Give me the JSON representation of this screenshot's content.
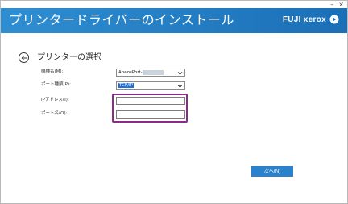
{
  "window": {
    "minimize_glyph": "–",
    "close_glyph": "×"
  },
  "header": {
    "title": "プリンタードライバーのインストール",
    "brand": "FUJI xerox",
    "brand_color": "#ffffff",
    "bar_color": "#2f8ed1"
  },
  "page": {
    "title": "プリンターの選択",
    "back_icon": "back-arrow-circle-icon"
  },
  "form": {
    "model_label": "機種名(M):",
    "model_value": "ApeosPort-",
    "port_type_label": "ポート種類(P):",
    "port_type_value": "TCP/IP",
    "ip_label": "IPアドレス(I):",
    "ip_value": "",
    "port_name_label": "ポート名(O):",
    "port_name_value": ""
  },
  "footer": {
    "next_label": "次へ(N)"
  },
  "colors": {
    "highlight": "#8b2a8b",
    "button": "#2a82cc"
  }
}
